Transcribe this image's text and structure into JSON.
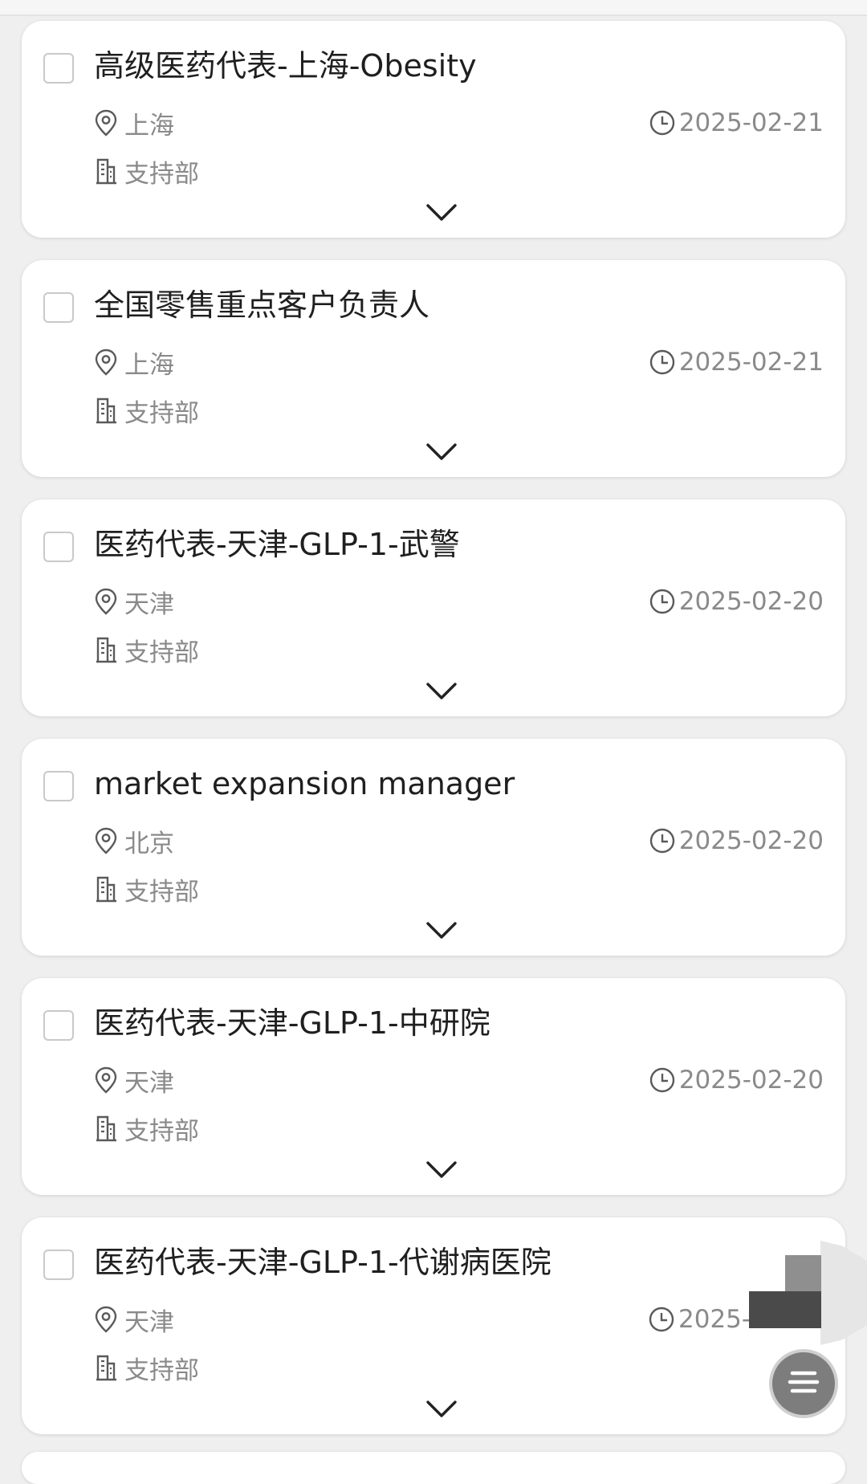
{
  "jobs": [
    {
      "title": "高级医药代表-上海-Obesity",
      "location": "上海",
      "department": "支持部",
      "date": "2025-02-21"
    },
    {
      "title": "全国零售重点客户负责人",
      "location": "上海",
      "department": "支持部",
      "date": "2025-02-21"
    },
    {
      "title": "医药代表-天津-GLP-1-武警",
      "location": "天津",
      "department": "支持部",
      "date": "2025-02-20"
    },
    {
      "title": "market expansion manager",
      "location": "北京",
      "department": "支持部",
      "date": "2025-02-20"
    },
    {
      "title": "医药代表-天津-GLP-1-中研院",
      "location": "天津",
      "department": "支持部",
      "date": "2025-02-20"
    },
    {
      "title": "医药代表-天津-GLP-1-代谢病医院",
      "location": "天津",
      "department": "支持部",
      "date": "2025-0"
    }
  ],
  "icons": {
    "location": "location-pin-icon",
    "department": "building-icon",
    "date": "clock-icon",
    "expand": "chevron-down-icon",
    "menu": "menu-icon"
  }
}
